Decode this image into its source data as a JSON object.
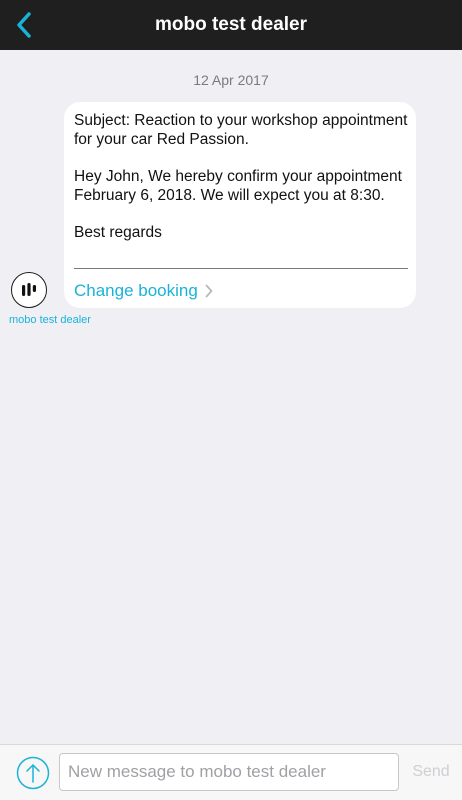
{
  "navbar": {
    "back_icon": "chevron-left-icon",
    "title": "mobo test dealer"
  },
  "thread": {
    "date": "12 Apr 2017",
    "message": {
      "subject": "Subject: Reaction to your workshop appointment for your car Red Passion.",
      "body": "Hey John, We hereby confirm your appointment February 6, 2018. We will expect you at 8:30.",
      "closing": "Best regards",
      "action_label": "Change booking",
      "action_icon": "chevron-right-icon"
    },
    "sender": {
      "name": "mobo test dealer",
      "avatar_icon": "mobo-logo-icon"
    }
  },
  "composer": {
    "attach_icon": "upload-arrow-icon",
    "input_value": "",
    "input_placeholder": "New message to mobo test dealer",
    "send_label": "Send"
  },
  "colors": {
    "navbar_bg": "#1f1f1f",
    "accent": "#1ab3d8",
    "background": "#efeff4",
    "bubble": "#ffffff"
  }
}
